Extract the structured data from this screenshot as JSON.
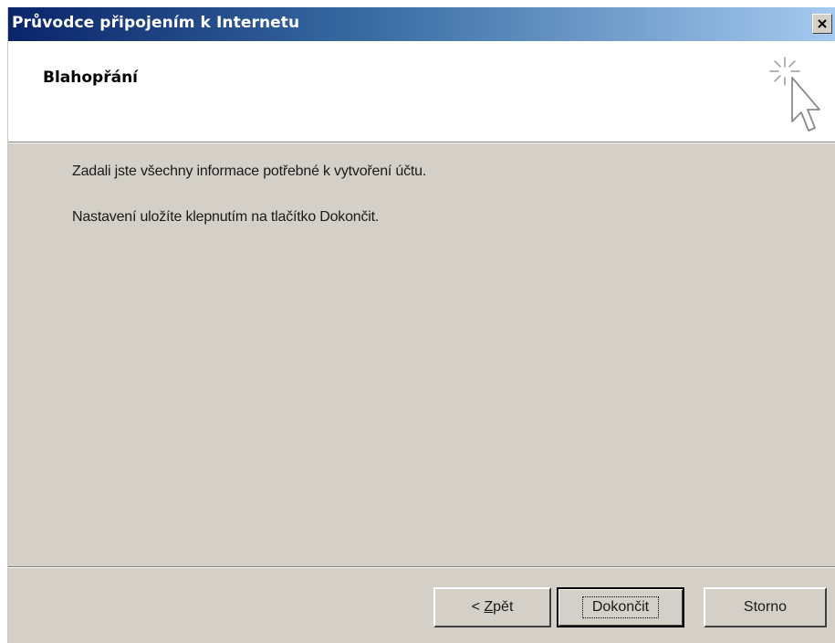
{
  "window": {
    "title": "Průvodce připojením k Internetu"
  },
  "header": {
    "title": "Blahopřání",
    "icon": "wizard-cursor-sparkle-icon"
  },
  "body": {
    "line1": "Zadali jste všechny informace potřebné k vytvoření účtu.",
    "line2": "Nastavení uložíte klepnutím na tlačítko Dokončit."
  },
  "buttons": {
    "back_prefix": "< ",
    "back_accel": "Z",
    "back_rest": "pět",
    "finish": "Dokončit",
    "cancel": "Storno"
  },
  "colors": {
    "title_gradient_start": "#0a246a",
    "title_gradient_end": "#a6caf0",
    "dialog_face": "#d4d0c8"
  }
}
